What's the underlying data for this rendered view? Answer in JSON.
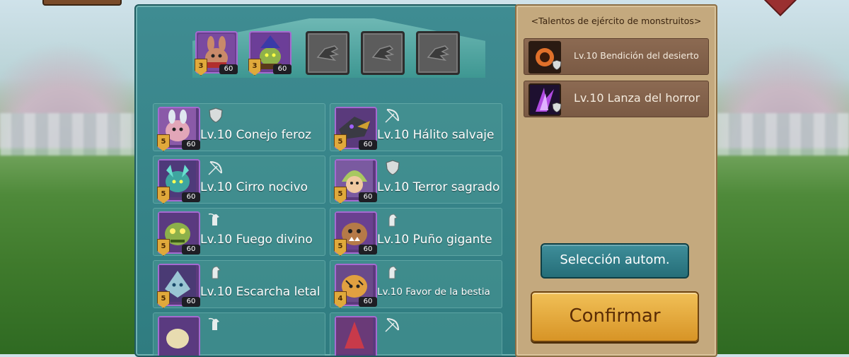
{
  "selected_slots": [
    {
      "type": "filled",
      "level": "60",
      "stars": "3",
      "portrait": "rabbit-monster"
    },
    {
      "type": "filled",
      "level": "60",
      "stars": "3",
      "portrait": "goblin-monster"
    },
    {
      "type": "empty",
      "icon": "dragon-head-icon"
    },
    {
      "type": "empty",
      "icon": "dragon-head-icon"
    },
    {
      "type": "empty",
      "icon": "dragon-head-icon"
    }
  ],
  "familiars": [
    {
      "label": "Lv.10 Conejo feroz",
      "stars": "5",
      "level": "60",
      "type_icon": "shield-icon"
    },
    {
      "label": "Lv.10 Hálito salvaje",
      "stars": "5",
      "level": "60",
      "type_icon": "bow-icon"
    },
    {
      "label": "Lv.10 Cirro nocivo",
      "stars": "5",
      "level": "60",
      "type_icon": "bow-icon"
    },
    {
      "label": "Lv.10 Terror sagrado",
      "stars": "5",
      "level": "60",
      "type_icon": "shield-icon"
    },
    {
      "label": "Lv.10 Fuego divino",
      "stars": "5",
      "level": "60",
      "type_icon": "archer-horse-icon"
    },
    {
      "label": "Lv.10 Puño gigante",
      "stars": "5",
      "level": "60",
      "type_icon": "horse-icon"
    },
    {
      "label": "Lv.10 Escarcha letal",
      "stars": "5",
      "level": "60",
      "type_icon": "horse-icon"
    },
    {
      "label": "Lv.10 Favor de la bestia",
      "stars": "4",
      "level": "60",
      "type_icon": "horse-icon"
    }
  ],
  "side_panel": {
    "title": "<Talentos de ejército de monstruitos>",
    "talents": [
      {
        "label": "Lv.10 Bendición del desierto",
        "icon": "desert-blessing-icon"
      },
      {
        "label": "Lv.10 Lanza del horror",
        "icon": "horror-lance-icon"
      }
    ],
    "auto_button": "Selección autom.",
    "confirm_button": "Confirmar"
  }
}
